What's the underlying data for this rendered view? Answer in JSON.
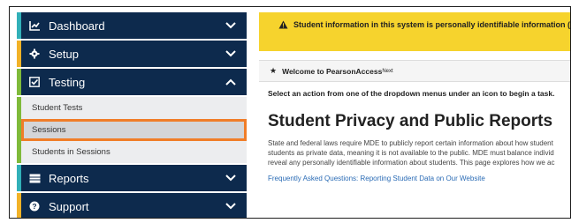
{
  "sidebar": {
    "items": [
      {
        "label": "Dashboard",
        "icon": "dashboard-icon",
        "accent": "#31b0b8"
      },
      {
        "label": "Setup",
        "icon": "gear-icon",
        "accent": "#f2b227"
      },
      {
        "label": "Testing",
        "icon": "checkbox-icon",
        "accent": "#7fba3a",
        "expanded": true
      },
      {
        "label": "Reports",
        "icon": "report-icon",
        "accent": "#31b0b8"
      },
      {
        "label": "Support",
        "icon": "question-icon",
        "accent": "#f2b227"
      }
    ],
    "testing_subitems": [
      {
        "label": "Student Tests"
      },
      {
        "label": "Sessions",
        "highlighted": true
      },
      {
        "label": "Students in Sessions"
      }
    ],
    "colors": {
      "nav_bg": "#0d2a4d",
      "highlight": "#f07d28"
    }
  },
  "main": {
    "pii_banner": "Student information in this system is personally identifiable information (PII);",
    "welcome": {
      "text": "Welcome to PearsonAccess",
      "superscript": "Next"
    },
    "instruction": "Select an action from one of the dropdown menus under an icon to begin a task.",
    "title": "Student Privacy and Public Reports",
    "paragraph_lines": [
      "State and federal laws require MDE to publicly report certain information about how student",
      "students as private data, meaning it is not available to the public. MDE must balance individ",
      "reveal any personally identifiable information about students. This page explores how we ac"
    ],
    "links": {
      "faq": "Frequently Asked Questions: Reporting Student Data on Our Website"
    },
    "colors": {
      "banner": "#f6d32d",
      "link": "#2a6bb5"
    }
  }
}
